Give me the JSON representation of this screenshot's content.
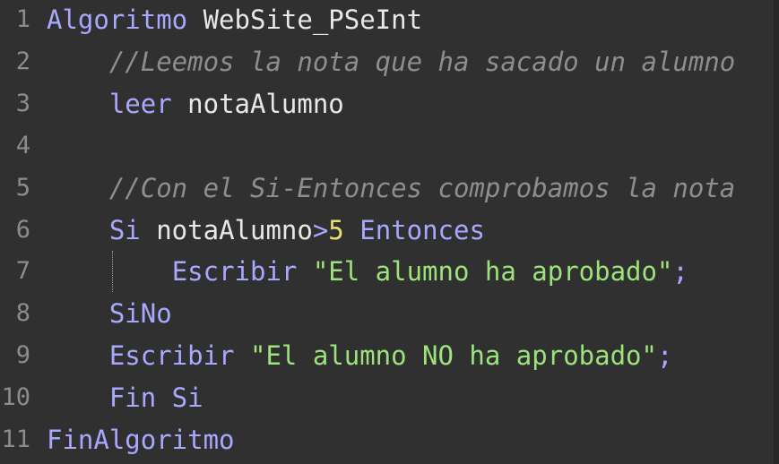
{
  "editor": {
    "line_numbers": [
      "1",
      "2",
      "3",
      "4",
      "5",
      "6",
      "7",
      "8",
      "9",
      "10",
      "11"
    ],
    "lines": [
      {
        "indent": "",
        "tokens": [
          {
            "t": "kw",
            "v": "Algoritmo"
          },
          {
            "t": "plain",
            "v": " WebSite_PSeInt"
          }
        ]
      },
      {
        "indent": "    ",
        "tokens": [
          {
            "t": "cm",
            "v": "//Leemos la nota que ha sacado un alumno"
          }
        ]
      },
      {
        "indent": "    ",
        "tokens": [
          {
            "t": "kw",
            "v": "leer"
          },
          {
            "t": "plain",
            "v": " notaAlumno"
          }
        ]
      },
      {
        "indent": "",
        "tokens": []
      },
      {
        "indent": "    ",
        "tokens": [
          {
            "t": "cm",
            "v": "//Con el Si-Entonces comprobamos la nota"
          }
        ]
      },
      {
        "indent": "    ",
        "tokens": [
          {
            "t": "kw",
            "v": "Si"
          },
          {
            "t": "plain",
            "v": " notaAlumno"
          },
          {
            "t": "op",
            "v": ">"
          },
          {
            "t": "num",
            "v": "5"
          },
          {
            "t": "plain",
            "v": " "
          },
          {
            "t": "kw",
            "v": "Entonces"
          }
        ]
      },
      {
        "indent": "        ",
        "tokens": [
          {
            "t": "kw",
            "v": "Escribir"
          },
          {
            "t": "plain",
            "v": " "
          },
          {
            "t": "str",
            "v": "\"El alumno ha aprobado\""
          },
          {
            "t": "op",
            "v": ";"
          }
        ]
      },
      {
        "indent": "    ",
        "tokens": [
          {
            "t": "kw",
            "v": "SiNo"
          }
        ]
      },
      {
        "indent": "    ",
        "tokens": [
          {
            "t": "kw",
            "v": "Escribir"
          },
          {
            "t": "plain",
            "v": " "
          },
          {
            "t": "str",
            "v": "\"El alumno NO ha aprobado\""
          },
          {
            "t": "op",
            "v": ";"
          }
        ]
      },
      {
        "indent": "    ",
        "tokens": [
          {
            "t": "kw",
            "v": "Fin Si"
          }
        ]
      },
      {
        "indent": "",
        "tokens": [
          {
            "t": "kw",
            "v": "FinAlgoritmo"
          }
        ]
      }
    ]
  },
  "colors": {
    "background": "#303030",
    "keyword": "#a9a8ff",
    "comment": "#8e8e8e",
    "string": "#9ce37c",
    "number": "#e8e070",
    "line_number": "#8c8c8c"
  }
}
